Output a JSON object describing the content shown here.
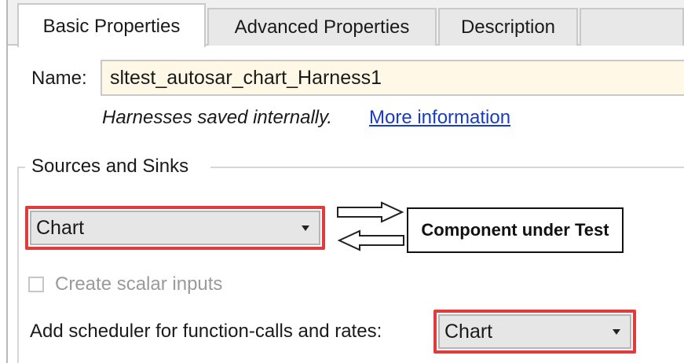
{
  "tabs": [
    {
      "label": "Basic Properties",
      "active": true
    },
    {
      "label": "Advanced Properties",
      "active": false
    },
    {
      "label": "Description",
      "active": false
    }
  ],
  "name": {
    "label": "Name:",
    "value": "sltest_autosar_chart_Harness1"
  },
  "harness_note": {
    "text": "Harnesses saved internally.",
    "link": "More information"
  },
  "sources_sinks": {
    "group_title": "Sources and Sinks",
    "selected": "Chart",
    "component_label": "Component under Test"
  },
  "scalar_inputs": {
    "label": "Create scalar inputs",
    "checked": false,
    "enabled": false
  },
  "scheduler": {
    "label": "Add scheduler for function-calls and rates:",
    "selected": "Chart"
  },
  "colors": {
    "highlight": "#e03c3c",
    "name_field_bg": "#fff8e6",
    "link": "#1a3cc4",
    "disabled_text": "#9a9a9a"
  },
  "icons": [
    "caret-down-icon",
    "arrow-right-icon",
    "arrow-left-icon"
  ]
}
